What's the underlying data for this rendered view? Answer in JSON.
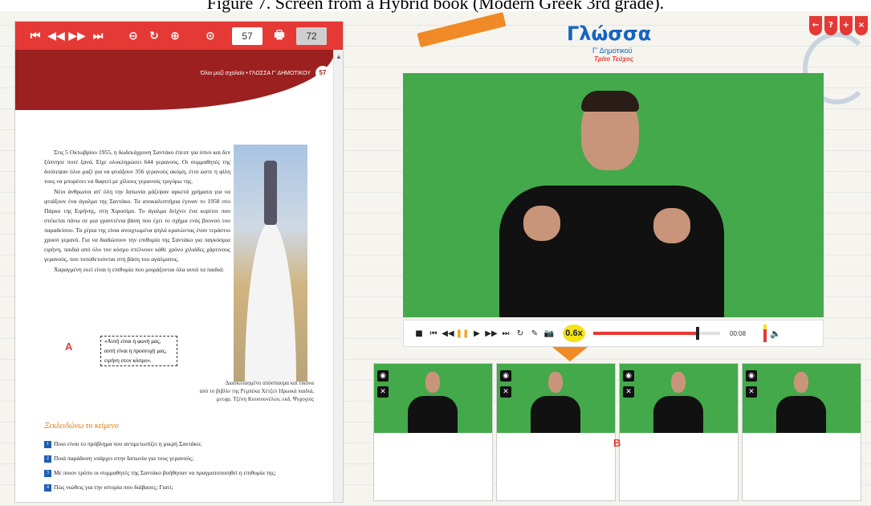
{
  "caption": "Figure 7. Screen from a Hybrid book (Modern Greek 3rd grade).",
  "book": {
    "toolbar": {
      "first": "⏮",
      "prev": "◀◀",
      "next": "▶▶",
      "last": "⏭",
      "zoom_out": "⊖",
      "rotate": "↻",
      "zoom_in": "⊕",
      "play": "⊙",
      "page": "57",
      "print": "🖶",
      "total": "72"
    },
    "header_text": "Όλοι μαζί σχολείο • ΓΛΩΣΣΑ Γ' ΔΗΜΟΤΙΚΟΥ",
    "page_number": "57",
    "paragraphs": [
      "Στις 5 Οκτωβρίου 1955, η δωδεκάχρονη Σαντάκο έπεσε για ύπνο και δεν ξύπνησε ποτέ ξανά. Είχε ολοκληρώσει 644 γερανούς. Οι συμμαθητές της δούλεψαν όλοι μαζί για να φτιάξουν 356 γερανούς ακόμη, έτσι ώστε η φίλη τους να μπορέσει να θαφτεί με χίλιους γερανούς τριγύρω της.",
      "Νέοι άνθρωποι απ' όλη την Ιαπωνία μάζεψαν αρκετά χρήματα για να φτιάξουν ένα άγαλμα της Σαντάκο. Τα αποκαλυπτήρια έγιναν το 1958 στο Πάρκο της Ειρήνης, στη Χιροσίμα. Το άγαλμα δείχνει ένα κορίτσι που στέκεται πάνω σε μια γρανιτένια βάση που έχει το σχήμα ενός βουνού του παραδείσου. Τα χέρια της είναι ανοιχτωμένα ψηλά κρατώντας έναν τεράστιο χρυσό γερανό. Για να διαδώσουν την επιθυμία της Σαντάκο για παγκόσμια ειρήνη, παιδιά από όλο τον κόσμο στέλνουν κάθε χρόνο χιλιάδες χάρτινους γερανούς, που τοποθετούνται στη βάση του αγάλματος.",
      "Χαραγμένη εκεί είναι η επιθυμία που μοιράζονται όλα αυτά τα παιδιά:"
    ],
    "quote_lines": [
      "«Αυτή είναι η φωνή μας,",
      "αυτή είναι η προσευχή μας,",
      "ειρήνη στον κόσμο»."
    ],
    "label_a": "A",
    "credit_lines": [
      "Διασκευασμένο απόσπασμα και εικόνα",
      "από το βιβλίο της Ρεμπέκα Χέτζελ Ηρωικά παιδιά,",
      "μετφρ. Τζένη Κουσουνέλου, εκδ. Ψυχογιός"
    ],
    "exercise_title": "Ξεκλειδώνω το κείμενο",
    "questions": [
      {
        "n": "1",
        "text": "Ποιο είναι το πρόβλημα που αντιμετωπίζει η μικρή Σαντάκο;"
      },
      {
        "n": "2",
        "text": "Ποιά παράδοση υπάρχει στην Ιαπωνία για τους γερανούς;"
      },
      {
        "n": "3",
        "text": "Με ποιον τρόπο οι συμμαθητές της Σαντάκο βοήθησαν να πραγματοποιηθεί η επιθυμία της;"
      },
      {
        "n": "4",
        "text": "Πώς νιώθεις για την ιστορία που διάβασες; Γιατί;"
      }
    ]
  },
  "app": {
    "logo": "Γλώσσα",
    "logo_sub1": "Γ' Δημοτικού",
    "logo_sub2": "Τρίτο Τεύχος",
    "corner_buttons": [
      "←",
      "?",
      "+",
      "×"
    ],
    "player": {
      "stop": "■",
      "first": "⏮",
      "rewind": "◀◀",
      "pause": "❚❚",
      "play": "▶",
      "forward": "▶▶",
      "last": "⏭",
      "replay": "↻",
      "edit": "✎",
      "camera": "📷",
      "speed": "0.6x",
      "time": "00:08",
      "progress": 0.82,
      "volume": "🔈"
    },
    "label_b": "B",
    "thumbs": [
      {
        "top_icon": "◉",
        "close_icon": "✕"
      },
      {
        "top_icon": "◉",
        "close_icon": "✕"
      },
      {
        "top_icon": "◉",
        "close_icon": "✕"
      },
      {
        "top_icon": "◉",
        "close_icon": "✕"
      }
    ]
  }
}
